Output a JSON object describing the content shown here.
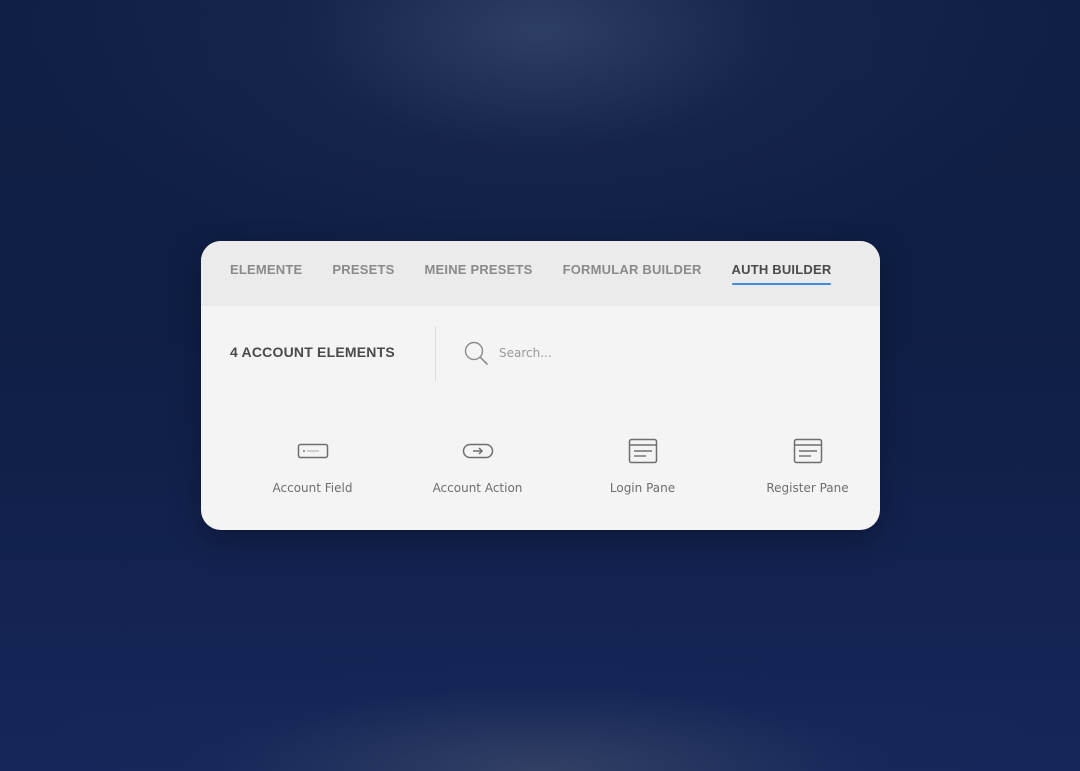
{
  "tabs": [
    {
      "label": "ELEMENTE",
      "active": false
    },
    {
      "label": "PRESETS",
      "active": false
    },
    {
      "label": "MEINE PRESETS",
      "active": false
    },
    {
      "label": "FORMULAR BUILDER",
      "active": false
    },
    {
      "label": "AUTH BUILDER",
      "active": true
    }
  ],
  "toolbar": {
    "title": "4 ACCOUNT ELEMENTS",
    "search": {
      "placeholder": "Search...",
      "value": "",
      "icon": "search-icon"
    }
  },
  "elements": [
    {
      "label": "Account Field",
      "icon": "input-field-icon"
    },
    {
      "label": "Account Action",
      "icon": "action-button-icon"
    },
    {
      "label": "Login Pane",
      "icon": "form-pane-icon"
    },
    {
      "label": "Register Pane",
      "icon": "form-pane-icon"
    }
  ],
  "colors": {
    "accent": "#3f8ede",
    "panel_background": "#f4f4f4",
    "tab_bar_background": "#ebebeb",
    "page_background": "#0f1e44"
  }
}
